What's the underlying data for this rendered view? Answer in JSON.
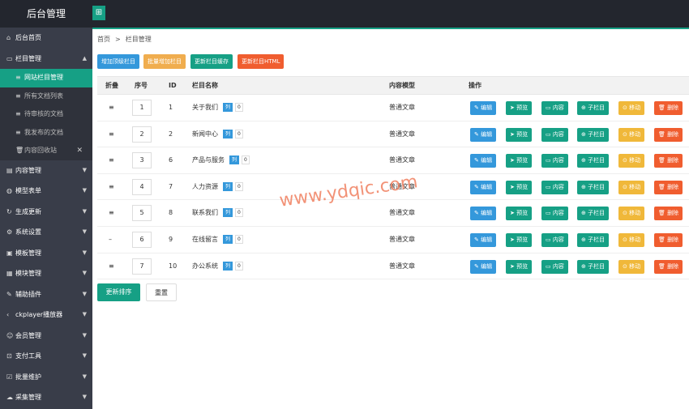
{
  "app": {
    "title": "后台管理",
    "toggle_icon": "grid-icon"
  },
  "colors": {
    "accent": "#16a085",
    "sidebar_bg": "#393d49",
    "topbar_bg": "#23262e"
  },
  "sidebar": {
    "items": [
      {
        "label": "后台首页",
        "icon": "home-icon"
      },
      {
        "label": "栏目管理",
        "icon": "monitor-icon",
        "open": true
      },
      {
        "label": "内容管理",
        "icon": "list-icon"
      },
      {
        "label": "模型表单",
        "icon": "globe-icon"
      },
      {
        "label": "生成更新",
        "icon": "refresh-icon"
      },
      {
        "label": "系统设置",
        "icon": "gear-icon"
      },
      {
        "label": "模板管理",
        "icon": "template-icon"
      },
      {
        "label": "模块管理",
        "icon": "cube-icon"
      },
      {
        "label": "辅助插件",
        "icon": "plugin-icon"
      },
      {
        "label": "ckplayer播放器",
        "icon": "player-icon"
      },
      {
        "label": "会员管理",
        "icon": "user-icon"
      },
      {
        "label": "支付工具",
        "icon": "cart-icon"
      },
      {
        "label": "批量维护",
        "icon": "check-icon"
      },
      {
        "label": "采集管理",
        "icon": "cloud-icon"
      }
    ],
    "sub_items": [
      {
        "label": "网站栏目管理",
        "active": true
      },
      {
        "label": "所有文档列表"
      },
      {
        "label": "待审核的文档"
      },
      {
        "label": "我发布的文档"
      },
      {
        "label": "内容回收站",
        "closable": true
      }
    ]
  },
  "breadcrumb": {
    "home": "首页",
    "sep": ">",
    "current": "栏目管理"
  },
  "toolbar": {
    "add_top": "增加顶级栏目",
    "batch_add": "批量增加栏目",
    "update_cache": "更新栏目缓存",
    "update_html": "更新栏目HTML"
  },
  "table": {
    "headers": {
      "fold": "折叠",
      "sort": "序号",
      "id": "ID",
      "name": "栏目名称",
      "model": "内容模型",
      "ops": "操作"
    },
    "list_badge": "列",
    "ops": {
      "edit": "编辑",
      "preview": "预览",
      "content": "内容",
      "sub": "子栏目",
      "move": "移动",
      "delete": "删除"
    },
    "rows": [
      {
        "fold": "≡",
        "sort": "1",
        "id": "1",
        "name": "关于我们",
        "count": "0",
        "model": "普通文章"
      },
      {
        "fold": "≡",
        "sort": "2",
        "id": "2",
        "name": "新闻中心",
        "count": "0",
        "model": "普通文章"
      },
      {
        "fold": "≡",
        "sort": "3",
        "id": "6",
        "name": "产品与服务",
        "count": "0",
        "model": "普通文章"
      },
      {
        "fold": "≡",
        "sort": "4",
        "id": "7",
        "name": "人力资源",
        "count": "0",
        "model": "普通文章"
      },
      {
        "fold": "≡",
        "sort": "5",
        "id": "8",
        "name": "联系我们",
        "count": "0",
        "model": "普通文章"
      },
      {
        "fold": "–",
        "sort": "6",
        "id": "9",
        "name": "在线留言",
        "count": "0",
        "model": "普通文章"
      },
      {
        "fold": "≡",
        "sort": "7",
        "id": "10",
        "name": "办公系统",
        "count": "0",
        "model": "普通文章"
      }
    ]
  },
  "footer": {
    "save": "更新排序",
    "reset": "重置"
  },
  "watermark": "www.ydqic.com"
}
